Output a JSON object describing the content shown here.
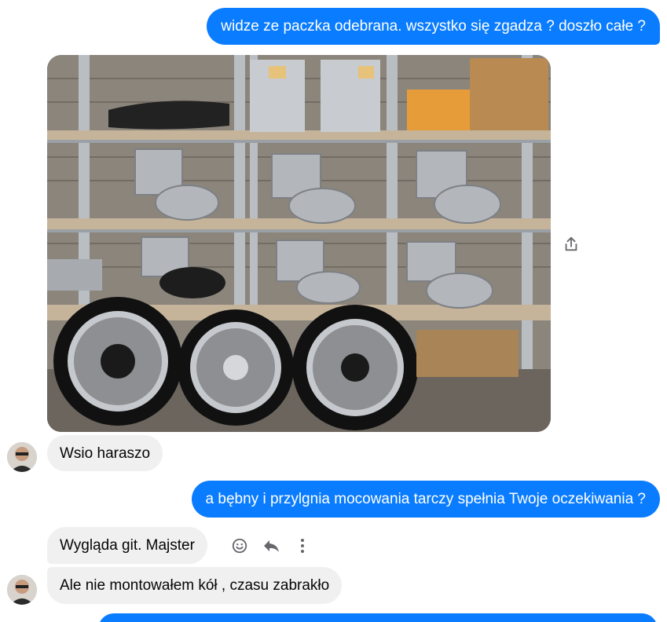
{
  "messages": {
    "msg1": "widze ze paczka odebrana. wszystko się zgadza ? doszło całe ?",
    "msg2": "Wsio haraszo",
    "msg3": "a bębny i przylgnia mocowania tarczy spełnia Twoje oczekiwania ?",
    "msg4": "Wygląda git. Majster",
    "msg5": "Ale nie montowałem kół , czasu zabrakło",
    "msg6": ""
  },
  "icons": {
    "share": "share-icon",
    "react": "smiley-icon",
    "reply": "reply-icon",
    "more": "more-vertical-icon",
    "avatar": "avatar"
  },
  "colors": {
    "outgoing_bubble": "#0a7cff",
    "incoming_bubble": "#f0f0f0",
    "icon_gray": "#65676b"
  }
}
